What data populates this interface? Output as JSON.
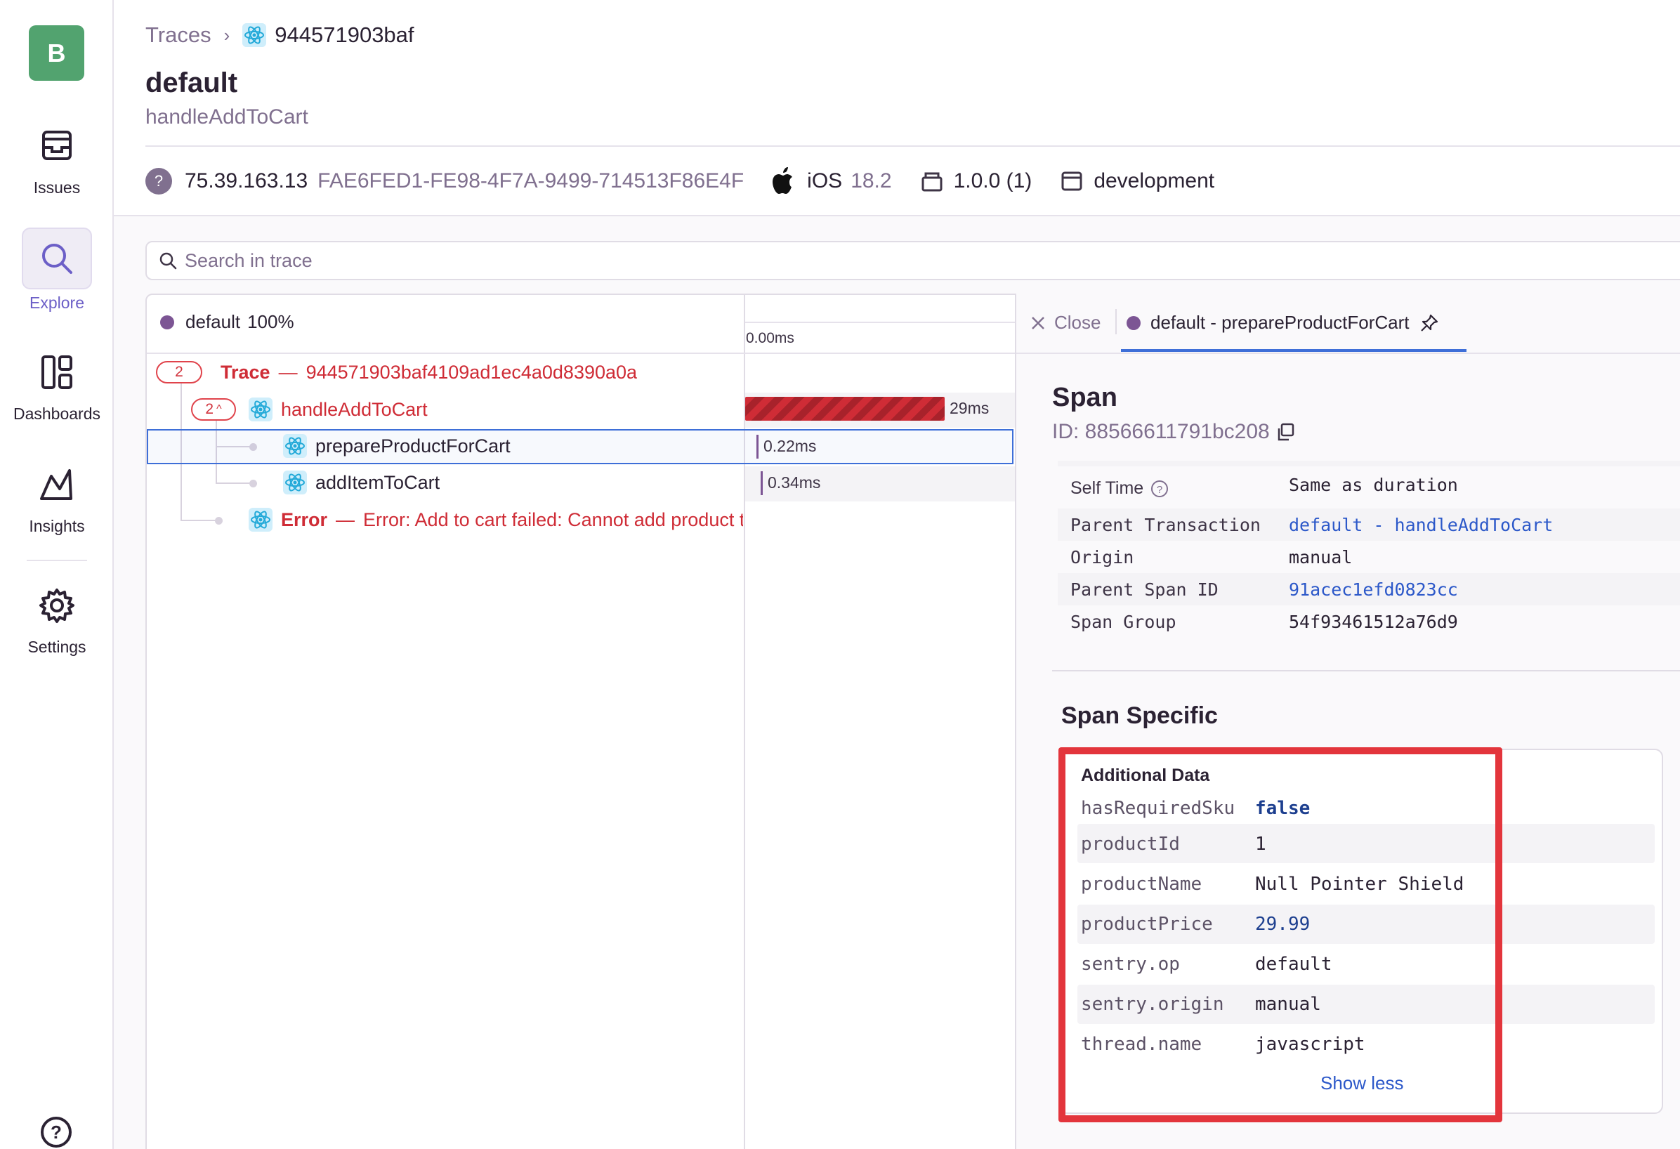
{
  "sidebar": {
    "org_initial": "B",
    "items": [
      {
        "label": "Issues",
        "icon": "inbox-icon"
      },
      {
        "label": "Explore",
        "icon": "search-icon"
      },
      {
        "label": "Dashboards",
        "icon": "dashboard-icon"
      },
      {
        "label": "Insights",
        "icon": "graph-icon"
      },
      {
        "label": "Settings",
        "icon": "gear-icon"
      }
    ],
    "active": "Explore",
    "help_icon": "help-icon"
  },
  "header": {
    "breadcrumb_root": "Traces",
    "breadcrumb_trace": "944571903baf",
    "title": "default",
    "subtitle": "handleAddToCart"
  },
  "meta": {
    "ip": "75.39.163.13",
    "device_id": "FAE6FED1-FE98-4F7A-9499-714513F86E4F",
    "os_name": "iOS",
    "os_version": "18.2",
    "release": "1.0.0 (1)",
    "environment": "development"
  },
  "search": {
    "placeholder": "Search in trace"
  },
  "trace": {
    "header": "default",
    "header_pct": "100%",
    "time_origin": "0.00ms",
    "rows": [
      {
        "count": "2",
        "label": "Trace",
        "dash": "—",
        "value": "944571903baf4109ad1ec4a0d8390a0a"
      },
      {
        "count": "2",
        "label": "handleAddToCart",
        "duration": "29ms"
      },
      {
        "label": "prepareProductForCart",
        "duration": "0.22ms"
      },
      {
        "label": "addItemToCart",
        "duration": "0.34ms"
      },
      {
        "label": "Error",
        "dash": "—",
        "value": "Error: Add to cart failed: Cannot add product t"
      }
    ]
  },
  "details": {
    "close_label": "Close",
    "tab_label": "default - prepareProductForCart",
    "section_title": "Span",
    "span_id": "ID: 88566611791bc208",
    "fields": [
      {
        "key": "Self Time",
        "value": "Same as duration"
      },
      {
        "key": "Parent Transaction",
        "value": "default - handleAddToCart"
      },
      {
        "key": "Origin",
        "value": "manual"
      },
      {
        "key": "Parent Span ID",
        "value": "91acec1efd0823cc"
      },
      {
        "key": "Span Group",
        "value": "54f93461512a76d9"
      }
    ],
    "span_specific_title": "Span Specific",
    "additional_data_title": "Additional Data",
    "additional_data": [
      {
        "key": "hasRequiredSku",
        "value": "false"
      },
      {
        "key": "productId",
        "value": "1"
      },
      {
        "key": "productName",
        "value": "Null Pointer Shield"
      },
      {
        "key": "productPrice",
        "value": "29.99"
      },
      {
        "key": "sentry.op",
        "value": "default"
      },
      {
        "key": "sentry.origin",
        "value": "manual"
      },
      {
        "key": "thread.name",
        "value": "javascript"
      }
    ],
    "show_less": "Show less"
  },
  "colors": {
    "accent": "#6c5fc7",
    "error": "#cf2c36",
    "link": "#2c58c9",
    "highlight_frame": "#e3353c"
  }
}
